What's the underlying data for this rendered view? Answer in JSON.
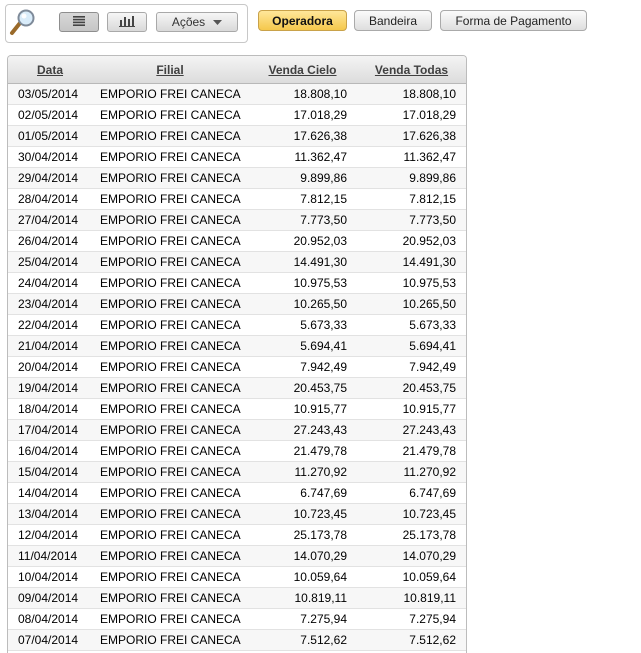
{
  "toolbar": {
    "actions_label": "Ações",
    "search_icon": "magnifier-search-icon",
    "view_icons": [
      "list-view-icon",
      "bar-chart-icon",
      "chevron-down-icon"
    ]
  },
  "pills": [
    {
      "label": "Operadora",
      "active": true
    },
    {
      "label": "Bandeira",
      "active": false
    },
    {
      "label": "Forma de Pagamento",
      "active": false
    }
  ],
  "colors": {
    "accent": "#f5c84c",
    "header_bg": "#dcdcdc"
  },
  "table": {
    "headers": {
      "data": "Data",
      "filial": "Filial",
      "venda_cielo": "Venda Cielo",
      "venda_todas": "Venda Todas"
    },
    "rows": [
      [
        "03/05/2014",
        "EMPORIO FREI CANECA",
        "18.808,10",
        "18.808,10"
      ],
      [
        "02/05/2014",
        "EMPORIO FREI CANECA",
        "17.018,29",
        "17.018,29"
      ],
      [
        "01/05/2014",
        "EMPORIO FREI CANECA",
        "17.626,38",
        "17.626,38"
      ],
      [
        "30/04/2014",
        "EMPORIO FREI CANECA",
        "11.362,47",
        "11.362,47"
      ],
      [
        "29/04/2014",
        "EMPORIO FREI CANECA",
        "9.899,86",
        "9.899,86"
      ],
      [
        "28/04/2014",
        "EMPORIO FREI CANECA",
        "7.812,15",
        "7.812,15"
      ],
      [
        "27/04/2014",
        "EMPORIO FREI CANECA",
        "7.773,50",
        "7.773,50"
      ],
      [
        "26/04/2014",
        "EMPORIO FREI CANECA",
        "20.952,03",
        "20.952,03"
      ],
      [
        "25/04/2014",
        "EMPORIO FREI CANECA",
        "14.491,30",
        "14.491,30"
      ],
      [
        "24/04/2014",
        "EMPORIO FREI CANECA",
        "10.975,53",
        "10.975,53"
      ],
      [
        "23/04/2014",
        "EMPORIO FREI CANECA",
        "10.265,50",
        "10.265,50"
      ],
      [
        "22/04/2014",
        "EMPORIO FREI CANECA",
        "5.673,33",
        "5.673,33"
      ],
      [
        "21/04/2014",
        "EMPORIO FREI CANECA",
        "5.694,41",
        "5.694,41"
      ],
      [
        "20/04/2014",
        "EMPORIO FREI CANECA",
        "7.942,49",
        "7.942,49"
      ],
      [
        "19/04/2014",
        "EMPORIO FREI CANECA",
        "20.453,75",
        "20.453,75"
      ],
      [
        "18/04/2014",
        "EMPORIO FREI CANECA",
        "10.915,77",
        "10.915,77"
      ],
      [
        "17/04/2014",
        "EMPORIO FREI CANECA",
        "27.243,43",
        "27.243,43"
      ],
      [
        "16/04/2014",
        "EMPORIO FREI CANECA",
        "21.479,78",
        "21.479,78"
      ],
      [
        "15/04/2014",
        "EMPORIO FREI CANECA",
        "11.270,92",
        "11.270,92"
      ],
      [
        "14/04/2014",
        "EMPORIO FREI CANECA",
        "6.747,69",
        "6.747,69"
      ],
      [
        "13/04/2014",
        "EMPORIO FREI CANECA",
        "10.723,45",
        "10.723,45"
      ],
      [
        "12/04/2014",
        "EMPORIO FREI CANECA",
        "25.173,78",
        "25.173,78"
      ],
      [
        "11/04/2014",
        "EMPORIO FREI CANECA",
        "14.070,29",
        "14.070,29"
      ],
      [
        "10/04/2014",
        "EMPORIO FREI CANECA",
        "10.059,64",
        "10.059,64"
      ],
      [
        "09/04/2014",
        "EMPORIO FREI CANECA",
        "10.819,11",
        "10.819,11"
      ],
      [
        "08/04/2014",
        "EMPORIO FREI CANECA",
        "7.275,94",
        "7.275,94"
      ],
      [
        "07/04/2014",
        "EMPORIO FREI CANECA",
        "7.512,62",
        "7.512,62"
      ]
    ]
  }
}
